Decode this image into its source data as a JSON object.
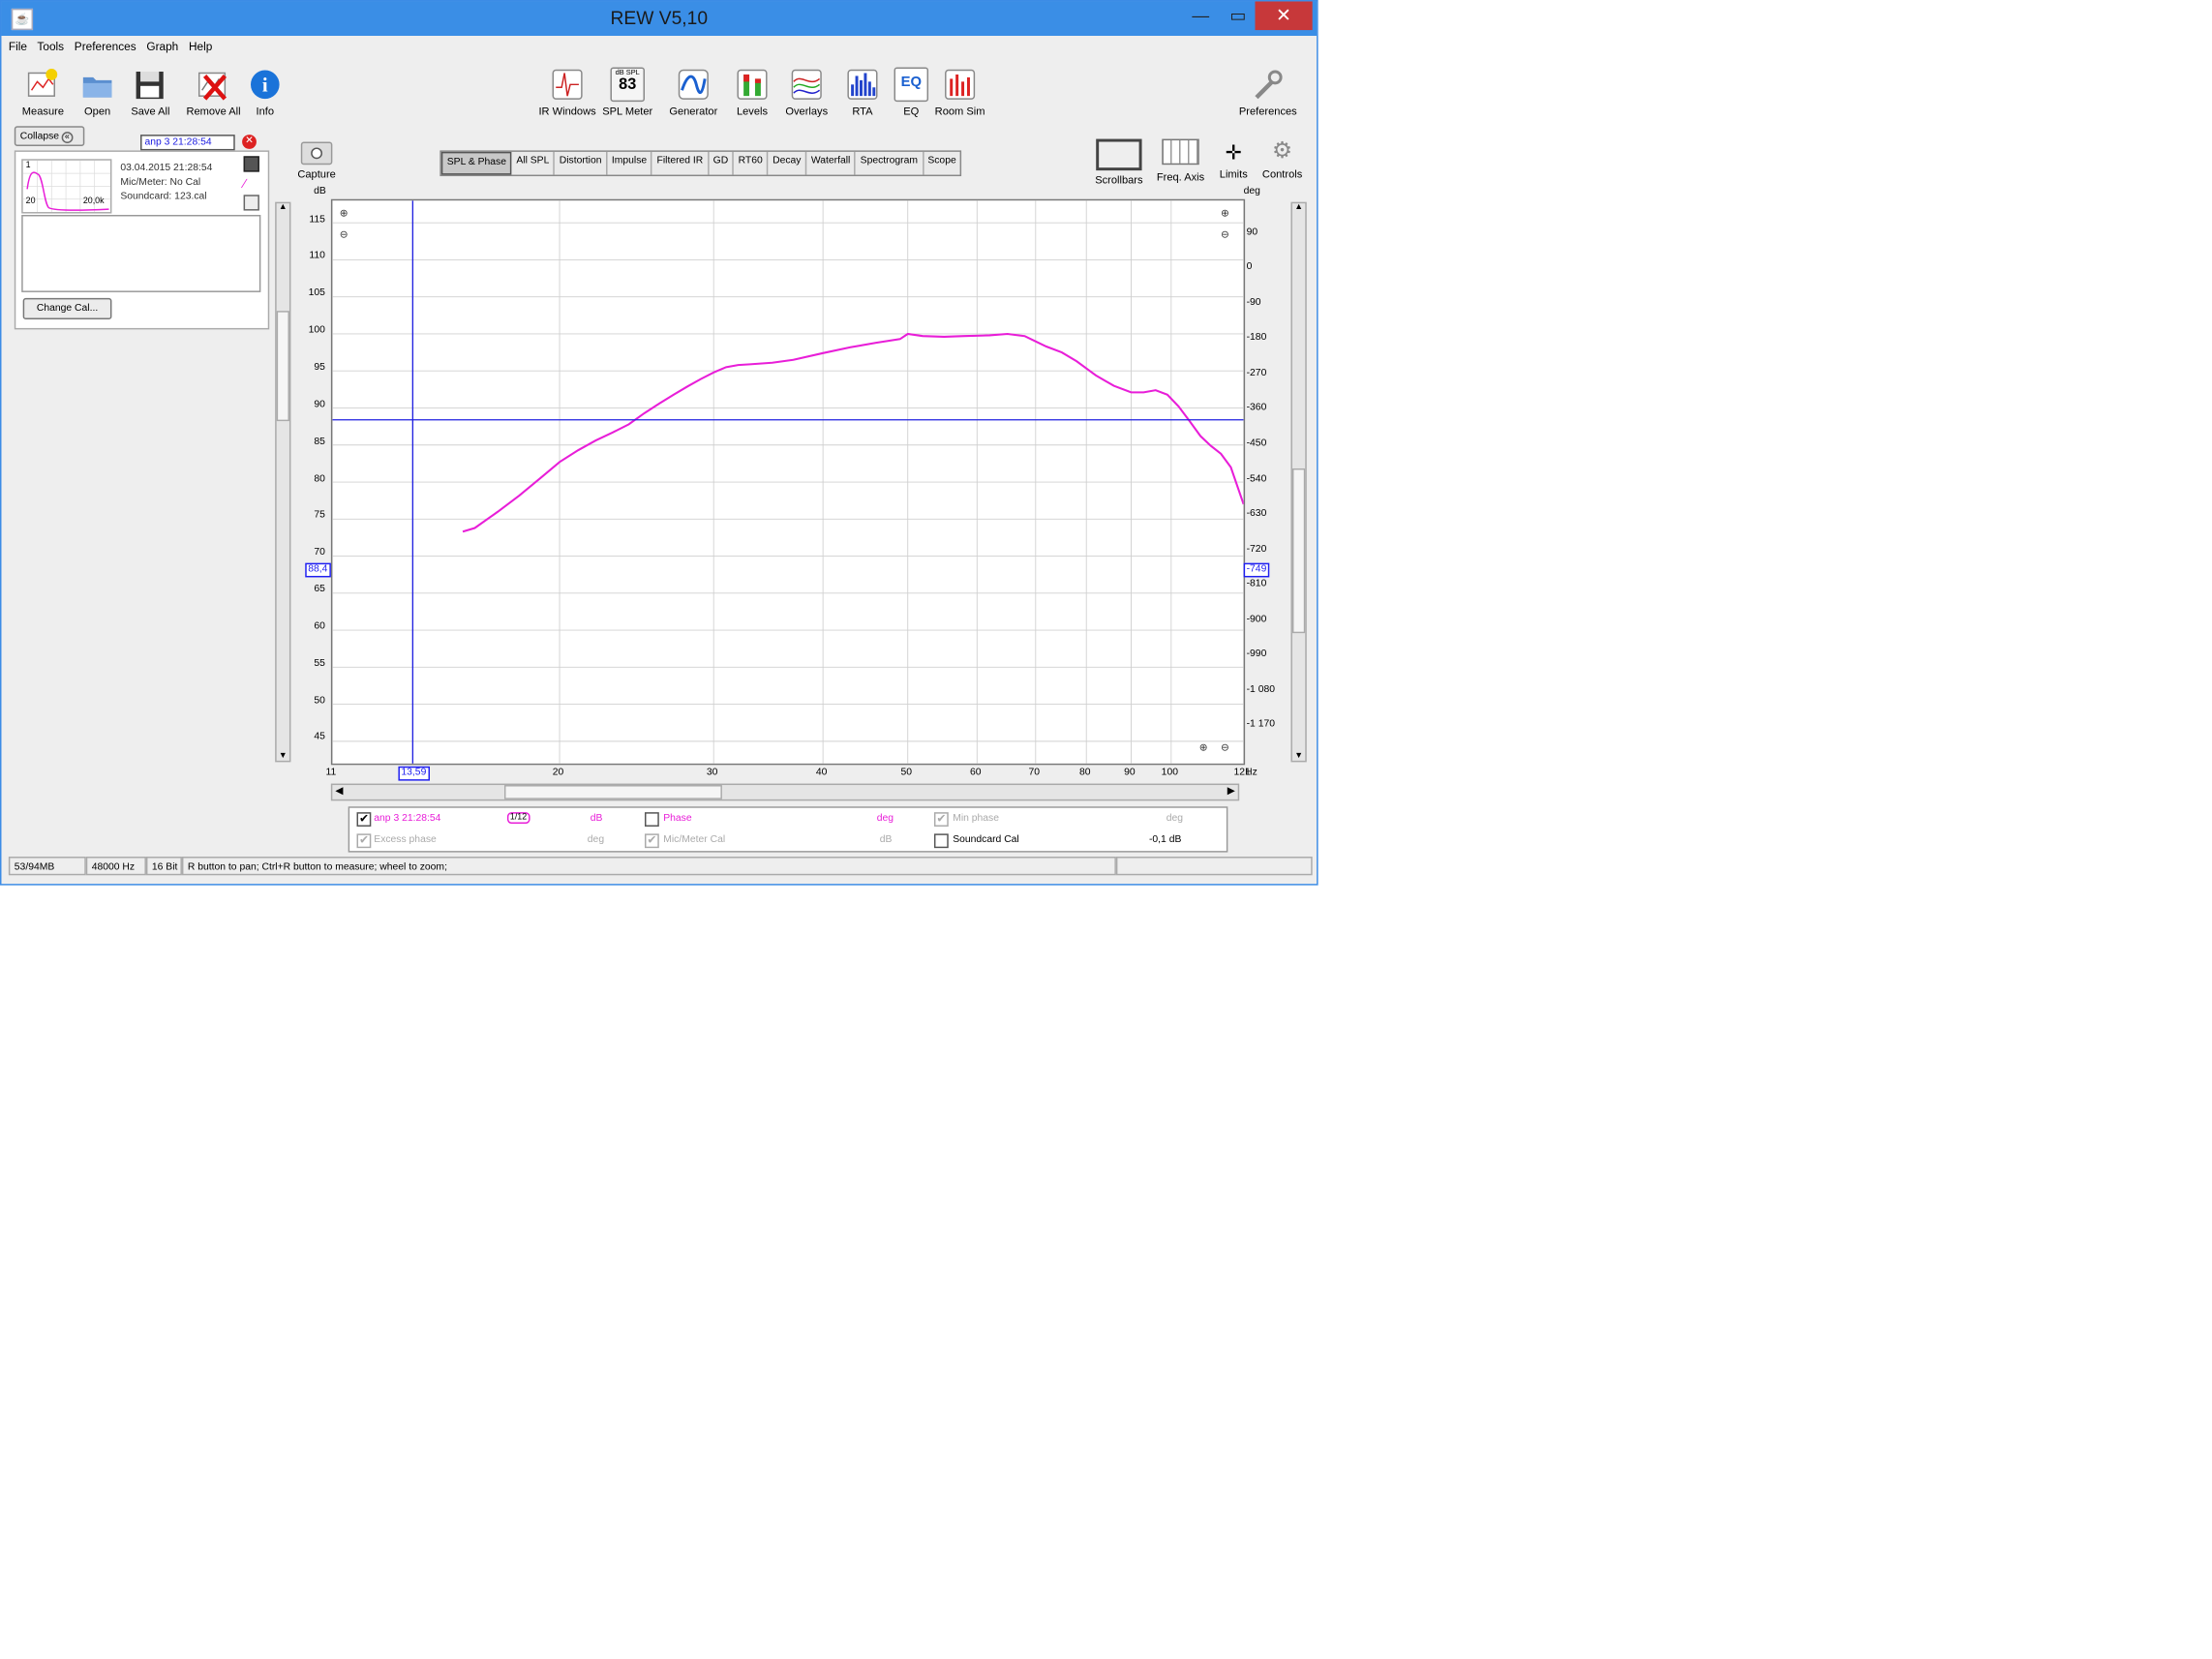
{
  "window": {
    "title": "REW V5,10"
  },
  "menu": [
    "File",
    "Tools",
    "Preferences",
    "Graph",
    "Help"
  ],
  "toolbar_left": [
    {
      "label": "Measure",
      "icon": "measure-icon"
    },
    {
      "label": "Open",
      "icon": "folder-icon"
    },
    {
      "label": "Save All",
      "icon": "save-icon"
    },
    {
      "label": "Remove All",
      "icon": "remove-icon"
    },
    {
      "label": "Info",
      "icon": "info-icon"
    }
  ],
  "toolbar_center": [
    {
      "label": "IR Windows",
      "icon": "ir-windows-icon"
    },
    {
      "label": "SPL Meter",
      "icon": "spl-meter-icon",
      "badge_top": "dB SPL",
      "badge_value": "83"
    },
    {
      "label": "Generator",
      "icon": "generator-icon"
    },
    {
      "label": "Levels",
      "icon": "levels-icon"
    },
    {
      "label": "Overlays",
      "icon": "overlays-icon"
    },
    {
      "label": "RTA",
      "icon": "rta-icon"
    },
    {
      "label": "EQ",
      "icon": "eq-icon",
      "badge_value": "EQ"
    },
    {
      "label": "Room Sim",
      "icon": "room-sim-icon"
    }
  ],
  "toolbar_right": {
    "label": "Preferences",
    "icon": "wrench-icon"
  },
  "side_panel": {
    "collapse_label": "Collapse",
    "measurement_name": "anp 3 21:28:54",
    "date": "03.04.2015 21:28:54",
    "mic": "Mic/Meter: No Cal",
    "soundcard": "Soundcard: 123.cal",
    "mini_labels": {
      "top": "1",
      "left": "20",
      "right": "20,0k"
    },
    "change_cal_label": "Change Cal..."
  },
  "capture": {
    "label": "Capture",
    "icon": "camera-icon"
  },
  "tabs": [
    "SPL & Phase",
    "All SPL",
    "Distortion",
    "Impulse",
    "Filtered IR",
    "GD",
    "RT60",
    "Decay",
    "Waterfall",
    "Spectrogram",
    "Scope"
  ],
  "selected_tab": "SPL & Phase",
  "right_tools": [
    {
      "label": "Scrollbars",
      "icon": "scrollbars-icon"
    },
    {
      "label": "Freq. Axis",
      "icon": "freq-axis-icon"
    },
    {
      "label": "Limits",
      "icon": "limits-icon"
    },
    {
      "label": "Controls",
      "icon": "gear-icon"
    }
  ],
  "axis_units": {
    "left": "dB",
    "right": "deg",
    "x": "Hz"
  },
  "cursor": {
    "x_readout": "13,59",
    "y_readout": "88,4",
    "right_readout": "-749"
  },
  "legend": {
    "row1": {
      "name": "anp 3 21:28:54",
      "smoothing": "1/12",
      "unit1": "dB",
      "phase_label": "Phase",
      "unit2": "deg",
      "min_phase_label": "Min phase",
      "unit3": "deg"
    },
    "row2": {
      "excess_label": "Excess phase",
      "unit1": "deg",
      "mic_cal_label": "Mic/Meter Cal",
      "unit2": "dB",
      "soundcard_label": "Soundcard Cal",
      "soundcard_value": "-0,1 dB"
    }
  },
  "status": {
    "memory": "53/94MB",
    "rate": "48000 Hz",
    "bits": "16 Bit",
    "hint": "R button to pan; Ctrl+R button to measure; wheel to zoom;"
  },
  "colors": {
    "trace": "#e81ed8",
    "cursor": "#2020e0",
    "titlebar": "#3a8ee6",
    "close": "#c7383a"
  },
  "chart_data": {
    "type": "line",
    "x_scale": "log",
    "xlim": [
      11,
      121
    ],
    "ylim": [
      42,
      118
    ],
    "y2lim": [
      -1260,
      180
    ],
    "x_ticks": [
      11,
      20,
      30,
      40,
      50,
      60,
      70,
      80,
      90,
      100,
      121
    ],
    "y_ticks": [
      115,
      110,
      105,
      100,
      95,
      90,
      85,
      80,
      75,
      70,
      65,
      60,
      55,
      50,
      45
    ],
    "y2_ticks": [
      90,
      0,
      -90,
      -180,
      -270,
      -360,
      -450,
      -540,
      -630,
      -720,
      -810,
      -900,
      -990,
      -1080,
      -1170
    ],
    "y2_tick_labels": [
      "90",
      "0",
      "-90",
      "-180",
      "-270",
      "-360",
      "-450",
      "-540",
      "-630",
      "-720",
      "-810",
      "-900",
      "-990",
      "-1 080",
      "-1 170"
    ],
    "grid": true,
    "series": [
      {
        "name": "anp 3 21:28:54",
        "x": [
          15.5,
          16,
          17,
          18,
          19,
          20,
          21,
          22,
          23,
          24,
          25,
          26,
          27,
          28,
          29,
          30,
          31,
          32,
          33,
          35,
          37,
          40,
          43,
          46,
          49,
          50,
          52,
          55,
          58,
          62,
          65,
          68,
          70,
          72,
          75,
          78,
          82,
          86,
          90,
          93,
          96,
          99,
          102,
          105,
          108,
          111,
          114,
          117,
          121
        ],
        "y": [
          73.3,
          73.8,
          76,
          78.2,
          80.5,
          82.7,
          84.3,
          85.6,
          86.7,
          87.8,
          89.3,
          90.6,
          91.8,
          92.9,
          93.9,
          94.8,
          95.5,
          95.8,
          95.9,
          96.1,
          96.5,
          97.4,
          98.2,
          98.8,
          99.3,
          100,
          99.7,
          99.6,
          99.7,
          99.8,
          100,
          99.7,
          99,
          98.3,
          97.5,
          96.3,
          94.4,
          93,
          92.1,
          92.1,
          92.4,
          91.8,
          90.2,
          88.2,
          86.2,
          84.9,
          83.8,
          82,
          77
        ]
      }
    ],
    "cursor_x": 13.59,
    "cursor_y": 88.4
  }
}
